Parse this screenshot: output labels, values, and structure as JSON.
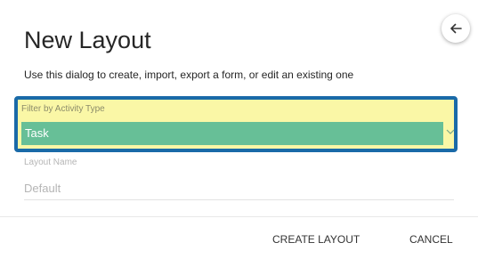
{
  "dialog": {
    "title": "New Layout",
    "subtitle": "Use this dialog to create, import, export a form, or edit an existing one",
    "back_icon": "arrow-left-icon"
  },
  "filter": {
    "label": "Filter by Activity Type",
    "selected": "Task",
    "chevron_icon": "chevron-down-icon"
  },
  "layout_name": {
    "label": "Layout Name",
    "placeholder": "Default",
    "value": ""
  },
  "actions": {
    "create_label": "CREATE LAYOUT",
    "cancel_label": "CANCEL"
  },
  "colors": {
    "highlight_border": "#1a6aa8",
    "highlight_fill": "#faf7a6",
    "select_fill": "#67bf97"
  }
}
